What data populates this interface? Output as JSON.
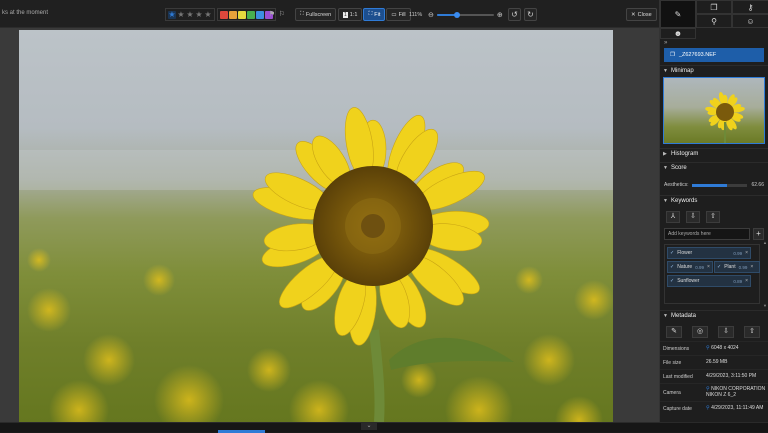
{
  "topbar": {
    "status": "ks at the moment",
    "rating": {
      "stars": 5
    },
    "color_labels": [
      "#e0483c",
      "#e8a23a",
      "#e6d93e",
      "#48b04f",
      "#3d8fe0",
      "#9a4fd1"
    ],
    "fullscreen_label": "Fullscreen",
    "zoom_1to1_label": "1:1",
    "fit_label": "Fit",
    "fill_label": "Fill",
    "zoom_percent": "111%",
    "zoom_level": 0.35,
    "close_label": "Close"
  },
  "panel": {
    "file_name": "_Z627693.NEF",
    "sections": {
      "minimap": "Minimap",
      "histogram": "Histogram",
      "score": "Score",
      "keywords": "Keywords",
      "metadata": "Metadata"
    },
    "score": {
      "label": "Aesthetics:",
      "value": "62.66",
      "fraction": 0.6266
    },
    "keywords": {
      "placeholder": "Add keywords here",
      "items": [
        {
          "label": "Flower",
          "score": "0.99"
        },
        {
          "label": "Nature",
          "score": "0.99"
        },
        {
          "label": "Plant",
          "score": "0.99"
        },
        {
          "label": "Sunflower",
          "score": "0.89"
        }
      ]
    },
    "metadata": {
      "rows": [
        {
          "key": "Dimensions",
          "value": "6048 x 4024"
        },
        {
          "key": "File size",
          "value": "26.59 MB"
        },
        {
          "key": "Last modified",
          "value": "4/29/2023, 3:11:50 PM"
        },
        {
          "key": "Camera",
          "value": "NIKON CORPORATION",
          "value2": "NIKON Z 6_2"
        },
        {
          "key": "Capture date",
          "value": "4/29/2023, 11:11:49 AM"
        }
      ]
    }
  }
}
